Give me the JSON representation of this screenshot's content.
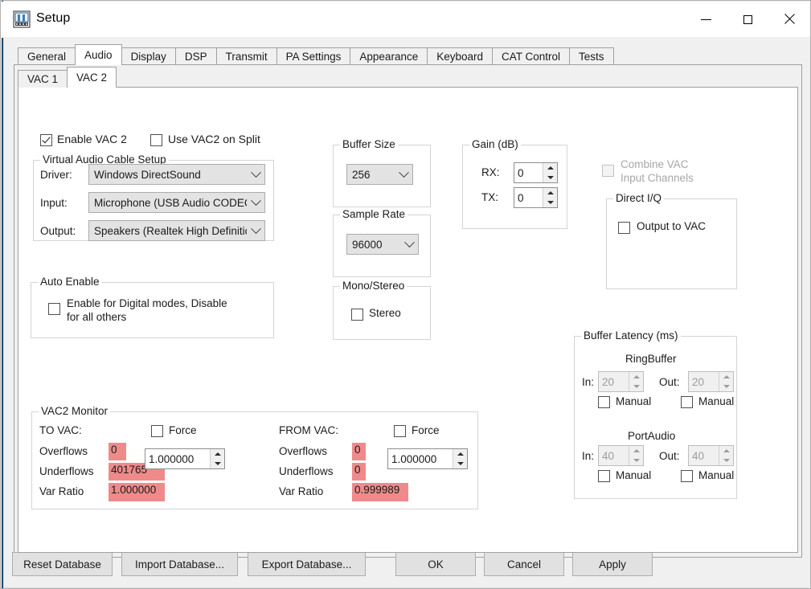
{
  "window": {
    "title": "Setup",
    "icon": "spectrum-display-icon",
    "minimize_label": "Minimize",
    "maximize_label": "Maximize",
    "close_label": "Close"
  },
  "tabs_primary": [
    {
      "label": "General",
      "active": false
    },
    {
      "label": "Audio",
      "active": true
    },
    {
      "label": "Display",
      "active": false
    },
    {
      "label": "DSP",
      "active": false
    },
    {
      "label": "Transmit",
      "active": false
    },
    {
      "label": "PA Settings",
      "active": false
    },
    {
      "label": "Appearance",
      "active": false
    },
    {
      "label": "Keyboard",
      "active": false
    },
    {
      "label": "CAT Control",
      "active": false
    },
    {
      "label": "Tests",
      "active": false
    }
  ],
  "tabs_secondary": [
    {
      "label": "VAC 1",
      "active": false
    },
    {
      "label": "VAC 2",
      "active": true
    }
  ],
  "top_checkboxes": {
    "enable_vac2": {
      "label": "Enable VAC 2",
      "checked": true
    },
    "use_vac2_on_split": {
      "label": "Use VAC2 on Split",
      "checked": false
    }
  },
  "vac_setup": {
    "title": "Virtual Audio Cable Setup",
    "driver_label": "Driver:",
    "driver_value": "Windows DirectSound",
    "input_label": "Input:",
    "input_value": "Microphone (USB Audio CODEC)",
    "output_label": "Output:",
    "output_value": "Speakers (Realtek High Definition"
  },
  "auto_enable": {
    "title": "Auto Enable",
    "checkbox_line1": "Enable for Digital modes, Disable",
    "checkbox_line2": "for all others",
    "checked": false
  },
  "buffer_size": {
    "title": "Buffer Size",
    "value": "256"
  },
  "sample_rate": {
    "title": "Sample Rate",
    "value": "96000"
  },
  "mono_stereo": {
    "title": "Mono/Stereo",
    "stereo_label": "Stereo",
    "stereo_checked": false
  },
  "gain": {
    "title": "Gain (dB)",
    "rx_label": "RX:",
    "rx_value": "0",
    "tx_label": "TX:",
    "tx_value": "0"
  },
  "combine_vac": {
    "line1": "Combine VAC",
    "line2": "Input Channels",
    "checked": false,
    "enabled": false
  },
  "direct_iq": {
    "title": "Direct I/Q",
    "output_to_vac_label": "Output to VAC",
    "checked": false
  },
  "vac2_monitor": {
    "title": "VAC2 Monitor",
    "to_vac": {
      "header": "TO VAC:",
      "force_label": "Force",
      "force_checked": false,
      "ratio_value": "1.000000",
      "rows": [
        {
          "label": "Overflows",
          "value": "0"
        },
        {
          "label": "Underflows",
          "value": "401765"
        },
        {
          "label": "Var Ratio",
          "value": "1.000000"
        }
      ]
    },
    "from_vac": {
      "header": "FROM VAC:",
      "force_label": "Force",
      "force_checked": false,
      "ratio_value": "1.000000",
      "rows": [
        {
          "label": "Overflows",
          "value": "0"
        },
        {
          "label": "Underflows",
          "value": "0"
        },
        {
          "label": "Var Ratio",
          "value": "0.999989"
        }
      ]
    }
  },
  "buffer_latency": {
    "title": "Buffer Latency (ms)",
    "ringbuffer": {
      "heading": "RingBuffer",
      "in_label": "In:",
      "in_value": "20",
      "in_manual_label": "Manual",
      "in_manual_checked": false,
      "out_label": "Out:",
      "out_value": "20",
      "out_manual_label": "Manual",
      "out_manual_checked": false
    },
    "portaudio": {
      "heading": "PortAudio",
      "in_label": "In:",
      "in_value": "40",
      "in_manual_label": "Manual",
      "in_manual_checked": false,
      "out_label": "Out:",
      "out_value": "40",
      "out_manual_label": "Manual",
      "out_manual_checked": false
    }
  },
  "footer_buttons": {
    "reset_database": "Reset Database",
    "import_database": "Import Database...",
    "export_database": "Export Database...",
    "ok": "OK",
    "cancel": "Cancel",
    "apply": "Apply"
  },
  "colors": {
    "alert_highlight": "#ef8a8a",
    "window_edge": "#1f4e6e",
    "dialog_bg": "#f0f0f0",
    "panel_bg": "#ffffff"
  }
}
